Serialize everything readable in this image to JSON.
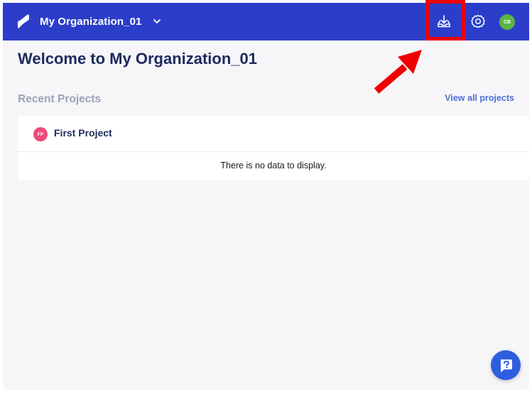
{
  "header": {
    "org_name": "My Organization_01",
    "avatar_initials": "CB",
    "colors": {
      "bar": "#2c3ec9",
      "avatar": "#5cb544"
    },
    "icons": [
      "logo-icon",
      "chevron-down-icon",
      "download-icon",
      "gear-icon"
    ]
  },
  "main": {
    "title": "Welcome to My Organization_01",
    "recent_label": "Recent Projects",
    "view_all_label": "View all projects",
    "projects": [
      {
        "initials": "FP",
        "name": "First Project",
        "color": "#ec4a7b",
        "empty_message": "There is no data to display."
      }
    ]
  },
  "help": {
    "icon": "help-chat-icon",
    "color": "#2e5ee0"
  },
  "annotation": {
    "highlight_color": "#ee0000"
  }
}
